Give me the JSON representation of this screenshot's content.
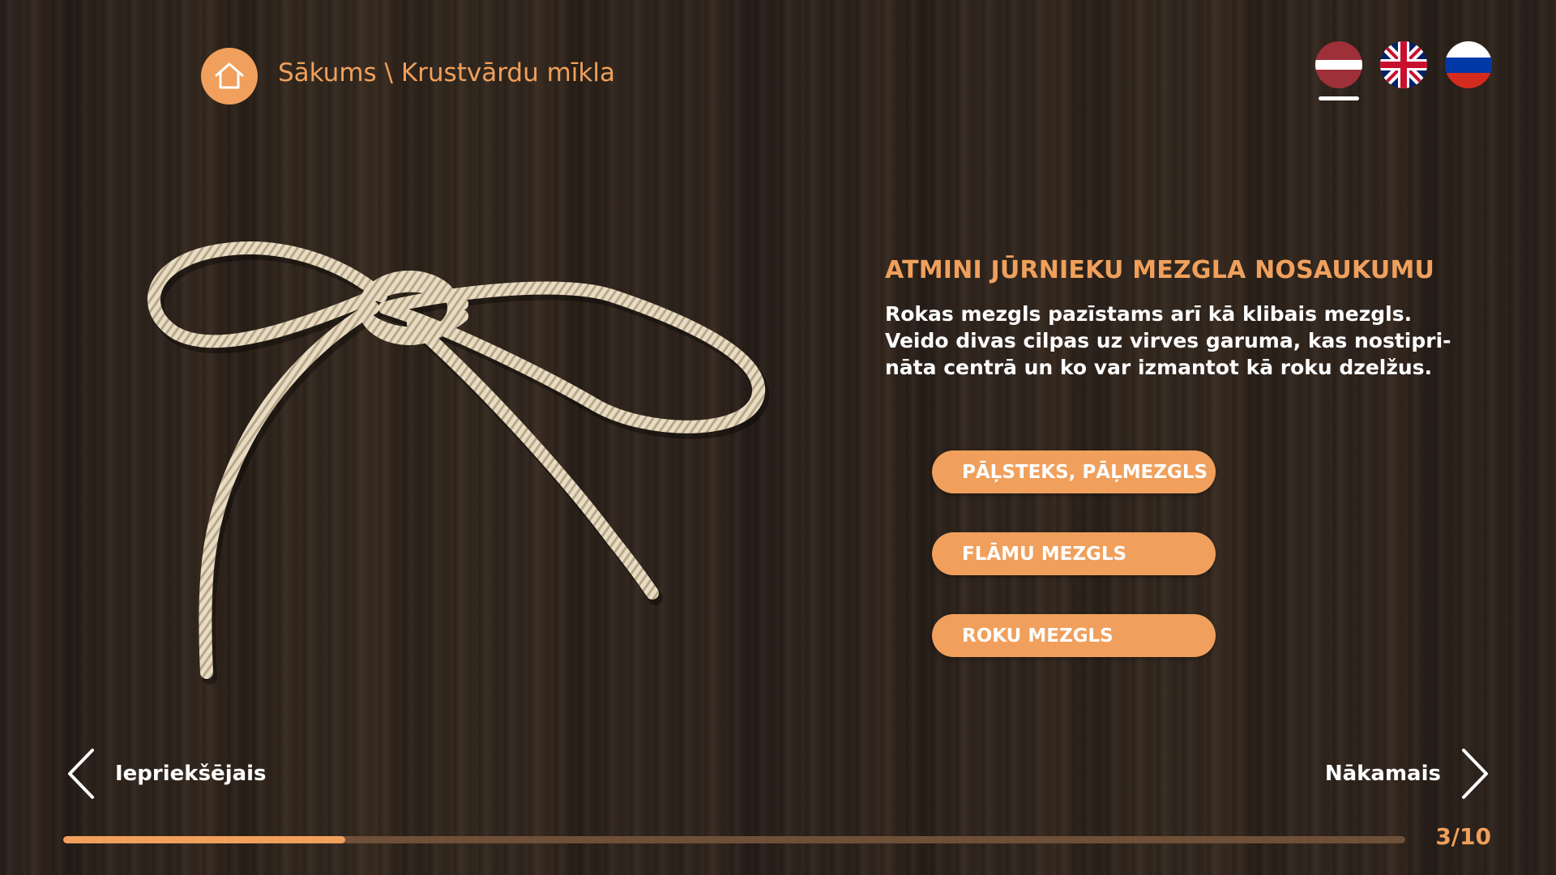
{
  "header": {
    "home_icon": "home-icon",
    "breadcrumb": {
      "home": "Sākums",
      "separator": " \\ ",
      "current": "Krustvārdu mīkla"
    }
  },
  "languages": [
    {
      "code": "lv",
      "icon": "latvia-flag-icon",
      "active": true
    },
    {
      "code": "en",
      "icon": "uk-flag-icon",
      "active": false
    },
    {
      "code": "ru",
      "icon": "russia-flag-icon",
      "active": false
    }
  ],
  "illustration": {
    "icon": "rope-knot-illustration"
  },
  "question": {
    "title": "ATMINI JŪRNIEKU MEZGLA NOSAUKUMU",
    "line1": "Rokas mezgls pazīstams arī kā klibais mezgls.",
    "line2": "Veido divas cilpas uz virves garuma, kas nostipri-",
    "line3": "nāta centrā un ko var izmantot kā roku dzelžus."
  },
  "answers": [
    {
      "label": "PĀĻSTEKS, PĀĻMEZGLS"
    },
    {
      "label": "FLĀMU MEZGLS"
    },
    {
      "label": "ROKU MEZGLS"
    }
  ],
  "navigation": {
    "prev_label": "Iepriekšējais",
    "next_label": "Nākamais",
    "prev_icon": "chevron-left-icon",
    "next_icon": "chevron-right-icon"
  },
  "progress": {
    "current": 3,
    "total": 10,
    "fraction": 0.21,
    "label": "3/10"
  },
  "colors": {
    "accent": "#f0a05c",
    "text": "#ffffff",
    "track": "#6e4f38"
  }
}
